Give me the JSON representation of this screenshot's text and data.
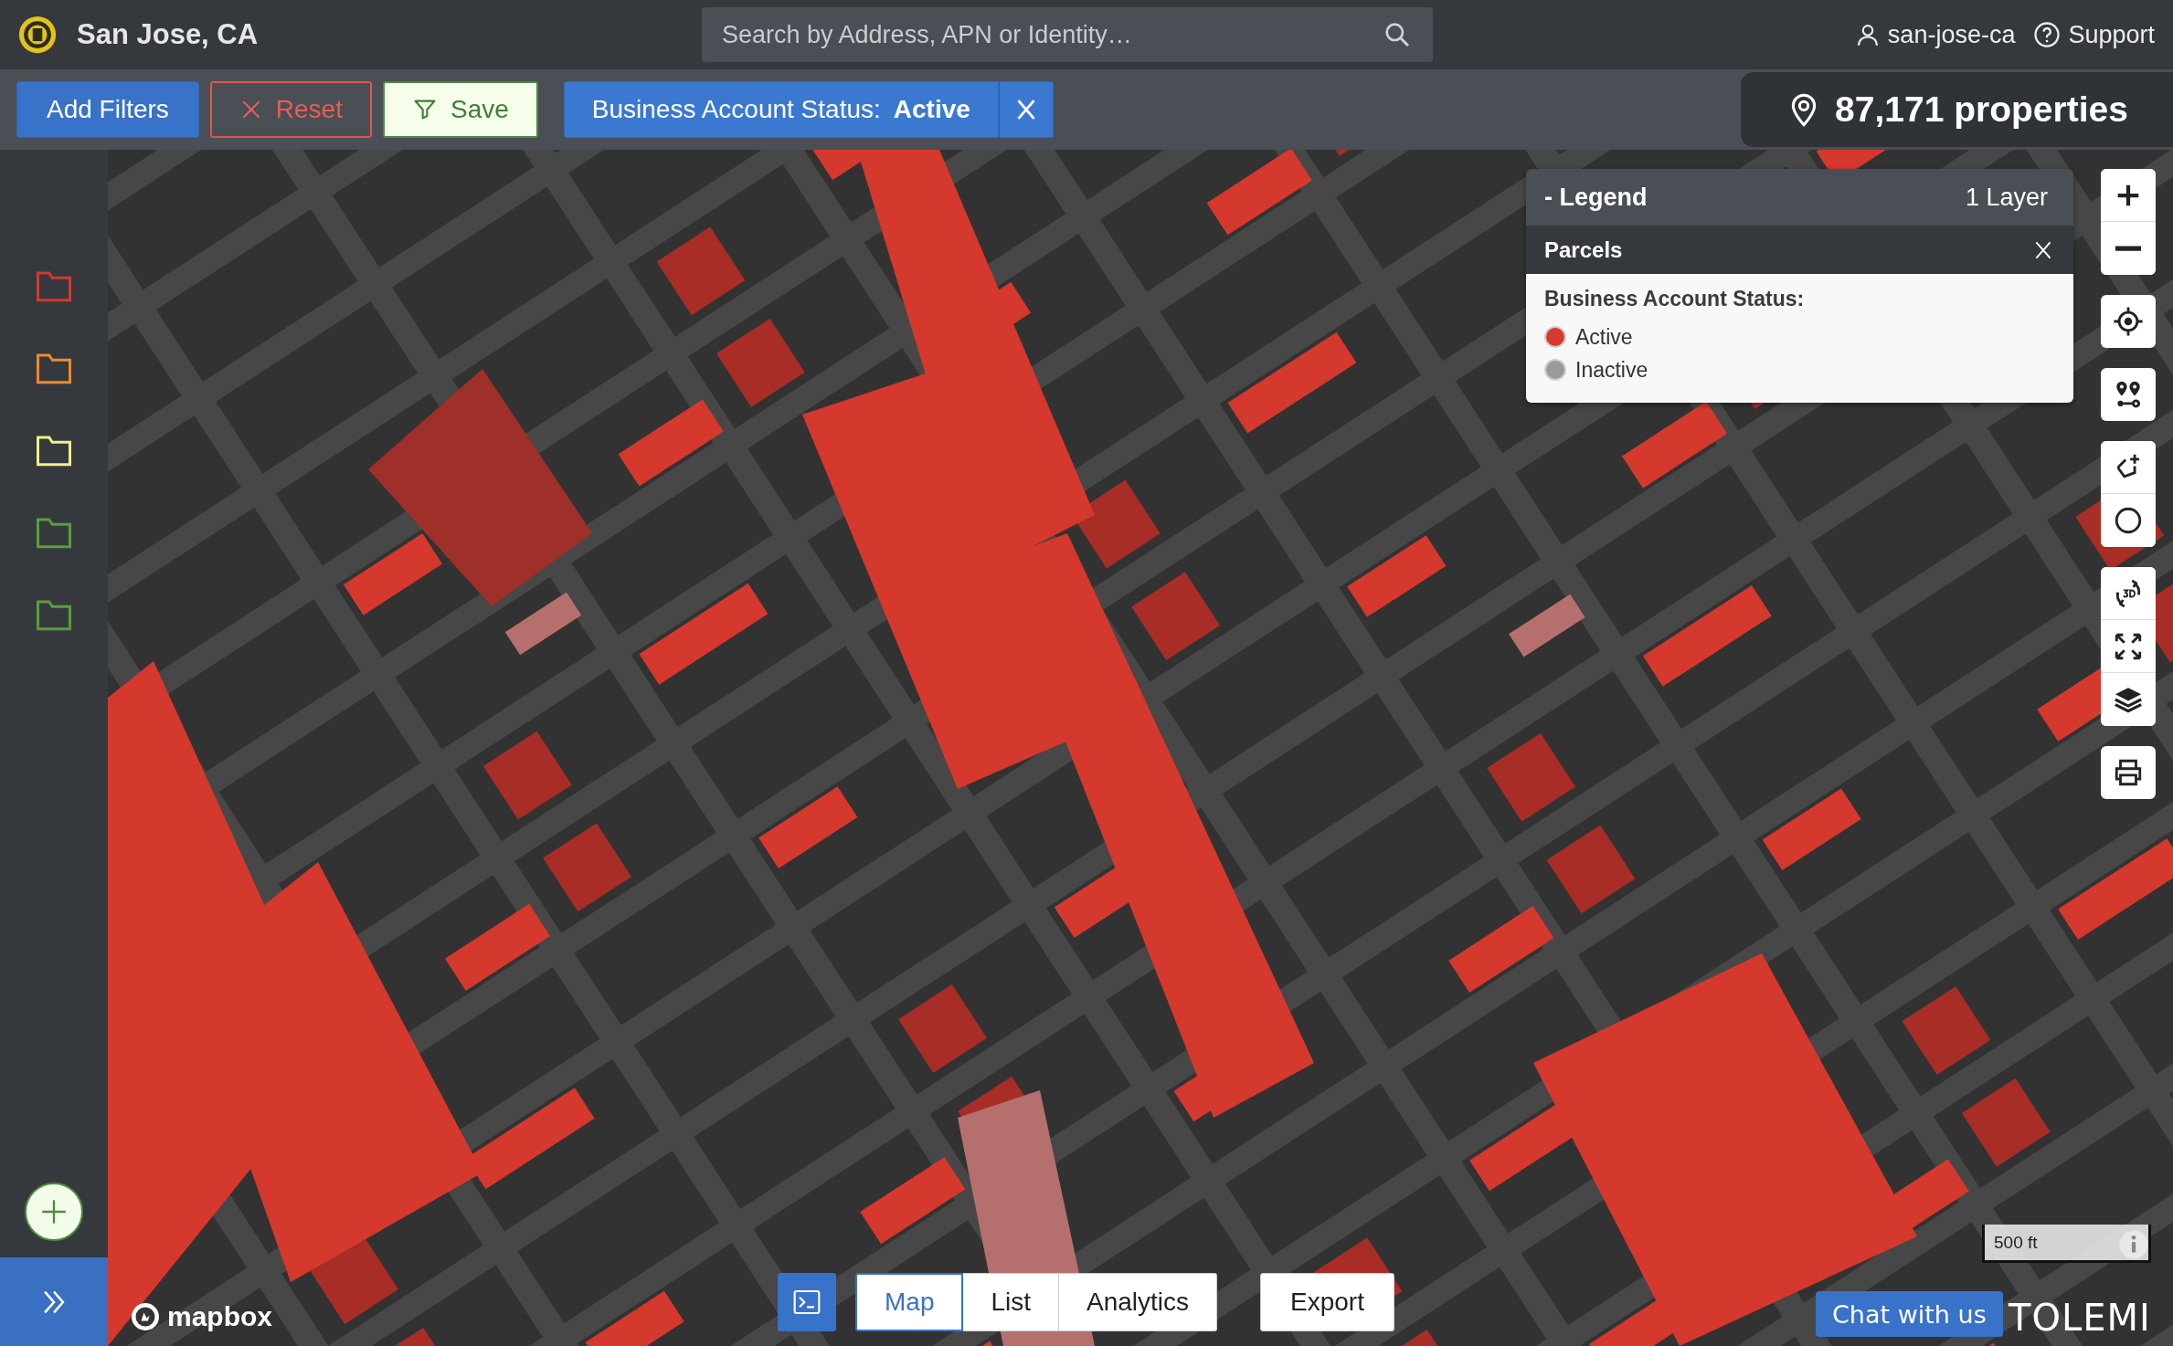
{
  "header": {
    "title": "San Jose, CA",
    "search": {
      "placeholder": "Search by Address, APN or Identity…"
    },
    "user": "san-jose-ca",
    "support": "Support"
  },
  "filter_bar": {
    "buttons": [
      {
        "label": "Add Filters",
        "kind": "primary"
      },
      {
        "label": "Reset",
        "kind": "danger"
      },
      {
        "label": "Save",
        "kind": "save"
      }
    ],
    "active_filter": "Business Account Status: **Active**",
    "property_count": "87,171 properties"
  },
  "sidebar": {
    "folders": [
      {
        "color": "#d23a2e"
      },
      {
        "color": "#ef8a2e"
      },
      {
        "color": "#f5f08a"
      },
      {
        "color": "#5a9e3c"
      },
      {
        "color": "#5a9e3c"
      }
    ]
  },
  "legend": {
    "title": "- Legend",
    "layer_count": "1 Layer",
    "layers": [
      {
        "name": "Parcels",
        "field": "Business Account Status:",
        "entries": [
          {
            "label": "Active",
            "color": "#d63a2f"
          },
          {
            "label": "Inactive",
            "color": "#9a9a9a"
          }
        ]
      }
    ]
  },
  "map": {
    "kind": "picture",
    "attribution": "mapbox",
    "scale": "500 ft"
  },
  "view_tabs": [
    {
      "label": "Map",
      "selected": true
    },
    {
      "label": "List",
      "selected": false
    },
    {
      "label": "Analytics",
      "selected": false
    }
  ],
  "export": "Export",
  "chat": "Chat with us",
  "brand": "TOLEMI"
}
